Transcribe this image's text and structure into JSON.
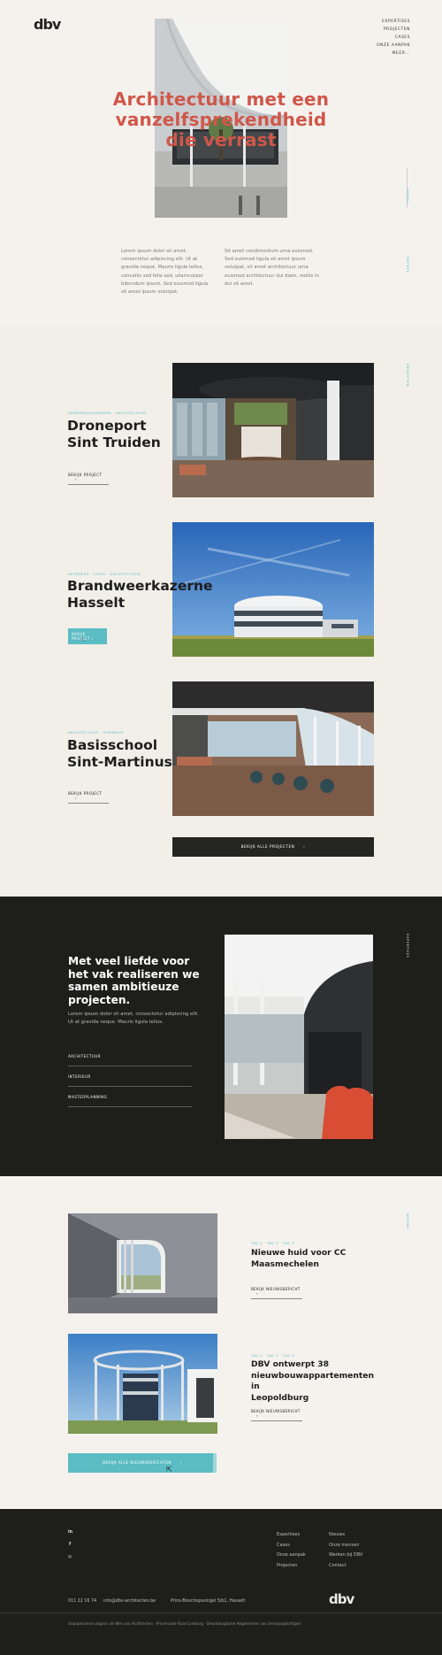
{
  "header": {
    "logo": "dbv",
    "nav": [
      "EXPERTISES",
      "PROJECTEN",
      "CASES",
      "ONZE AANPAK",
      "MEER..."
    ]
  },
  "hero": {
    "title_lines": [
      "Architectuur met een",
      "vanzelfsprekendheid",
      "die verrast"
    ],
    "side_label_top": "SCROLL",
    "side_label_bottom": "ONTDEK",
    "col1": "Lorem ipsum dolor sit amet, consectetur adipiscing elit. Ut at gravida neque. Mauris ligula tellus, convallis sed felis sed, ullamcorper bibendum ipsum. Sed euismod ligula sit amet ipsum volutpat.",
    "col2": "Sit amet condimentum urna euismod. Sed euismod ligula sit amet ipsum volutpat, sit amet architectuur urna euismod architectuur dui diam, mollis in dui sit amet."
  },
  "projects": {
    "side_label": "PROJECTEN",
    "items": [
      {
        "category": "GEMEENSCHAPSWERK · ARCHITECTUUR",
        "title_lines": [
          "Droneport",
          "Sint Truiden"
        ],
        "button": "BEKIJK PROJECT"
      },
      {
        "category": "INTERIEUR · CIVIEL · ARCHITECTUUR",
        "title_lines": [
          "Brandweerkazerne",
          "Hasselt"
        ],
        "button": "BEKIJK PROJECT"
      },
      {
        "category": "ARCHITECTUUR · INTERIEUR",
        "title_lines": [
          "Basisschool",
          "Sint-Martinus"
        ],
        "button": "BEKIJK PROJECT"
      }
    ],
    "all_button": "BEKIJK ALLE PROJECTEN"
  },
  "expertise": {
    "side_label": "EXPERTISES",
    "title_lines": [
      "Met veel liefde voor",
      "het vak realiseren we",
      "samen ambitieuze",
      "projecten."
    ],
    "paragraph_lines": [
      "Lorem ipsum dolor sit amet, consectetur adipiscing elit.",
      "Ut at gravida neque. Mauris ligula tellus."
    ],
    "links": [
      "ARCHITECTUUR",
      "INTERIEUR",
      "MASTERPLANNING"
    ]
  },
  "news": {
    "side_label": "NIEUWS",
    "items": [
      {
        "tag": "TAG 1 · TAG 2 · TAG 3",
        "title_lines": [
          "Nieuwe huid voor CC",
          "Maasmechelen"
        ],
        "button": "BEKIJK NIEUWSBERICHT"
      },
      {
        "tag": "TAG 1 · TAG 2 · TAG 3",
        "title_lines": [
          "DBV ontwerpt 38",
          "nieuwbouwappartementen in",
          "Leopoldburg"
        ],
        "button": "BEKIJK NIEUWSBERICHT"
      }
    ],
    "all_button": "BEKIJK ALLE NIEUWSBERICHTEN"
  },
  "footer": {
    "logo": "dbv",
    "social": [
      "in",
      "f",
      "◎"
    ],
    "col1": [
      "Expertises",
      "Cases",
      "Onze aanpak",
      "Projecten"
    ],
    "col2": [
      "Nieuws",
      "Onze mensen",
      "Werken bij DBV",
      "Contact"
    ],
    "phone": "011 22 16 74",
    "email": "info@dbv-architecten.be",
    "address": "Prins-Bisschopssingel 5/b1, Hasselt",
    "legal": "Gepubliceerd volgens de Wet van Architecten · Provinciale Raad Limburg · Deontologische Regelement van beroepsplichtigen"
  },
  "colors": {
    "accent": "#5bbcc4",
    "hero_title": "#d0574a",
    "dark": "#1e1e1b"
  }
}
